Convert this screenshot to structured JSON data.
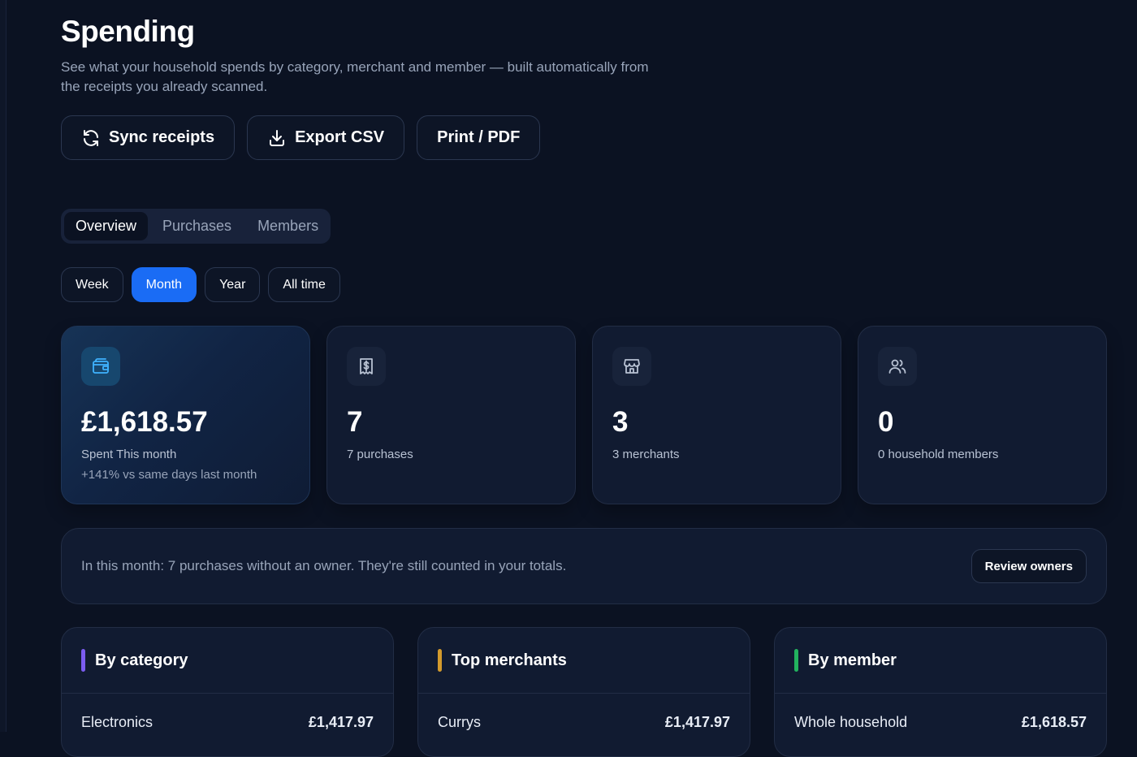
{
  "header": {
    "title": "Spending",
    "subtitle": "See what your household spends by category, merchant and member — built automatically from the receipts you already scanned."
  },
  "actions": {
    "sync": {
      "label": "Sync receipts",
      "icon": "refresh-icon"
    },
    "export": {
      "label": "Export CSV",
      "icon": "download-icon"
    },
    "print": {
      "label": "Print / PDF"
    }
  },
  "tabs": [
    {
      "label": "Overview",
      "active": true
    },
    {
      "label": "Purchases",
      "active": false
    },
    {
      "label": "Members",
      "active": false
    }
  ],
  "ranges": [
    {
      "label": "Week",
      "active": false
    },
    {
      "label": "Month",
      "active": true
    },
    {
      "label": "Year",
      "active": false
    },
    {
      "label": "All time",
      "active": false
    }
  ],
  "stats": [
    {
      "icon": "wallet-icon",
      "value": "£1,618.57",
      "label": "Spent This month",
      "sub": "+141% vs same days last month"
    },
    {
      "icon": "receipt-icon",
      "value": "7",
      "label": "7 purchases"
    },
    {
      "icon": "store-icon",
      "value": "3",
      "label": "3 merchants"
    },
    {
      "icon": "users-icon",
      "value": "0",
      "label": "0 household members"
    }
  ],
  "notice": {
    "message": "In this month: 7 purchases without an owner. They're still counted in your totals.",
    "button": "Review owners"
  },
  "panels": [
    {
      "title": "By category",
      "accent": "#7b5cf0",
      "row": {
        "name": "Electronics",
        "amount": "£1,417.97"
      }
    },
    {
      "title": "Top merchants",
      "accent": "#d39a2c",
      "row": {
        "name": "Currys",
        "amount": "£1,417.97"
      }
    },
    {
      "title": "By member",
      "accent": "#22b35e",
      "row": {
        "name": "Whole household",
        "amount": "£1,618.57"
      }
    }
  ],
  "colors": {
    "accent": "#1a6cf5",
    "background": "#0b1222"
  }
}
